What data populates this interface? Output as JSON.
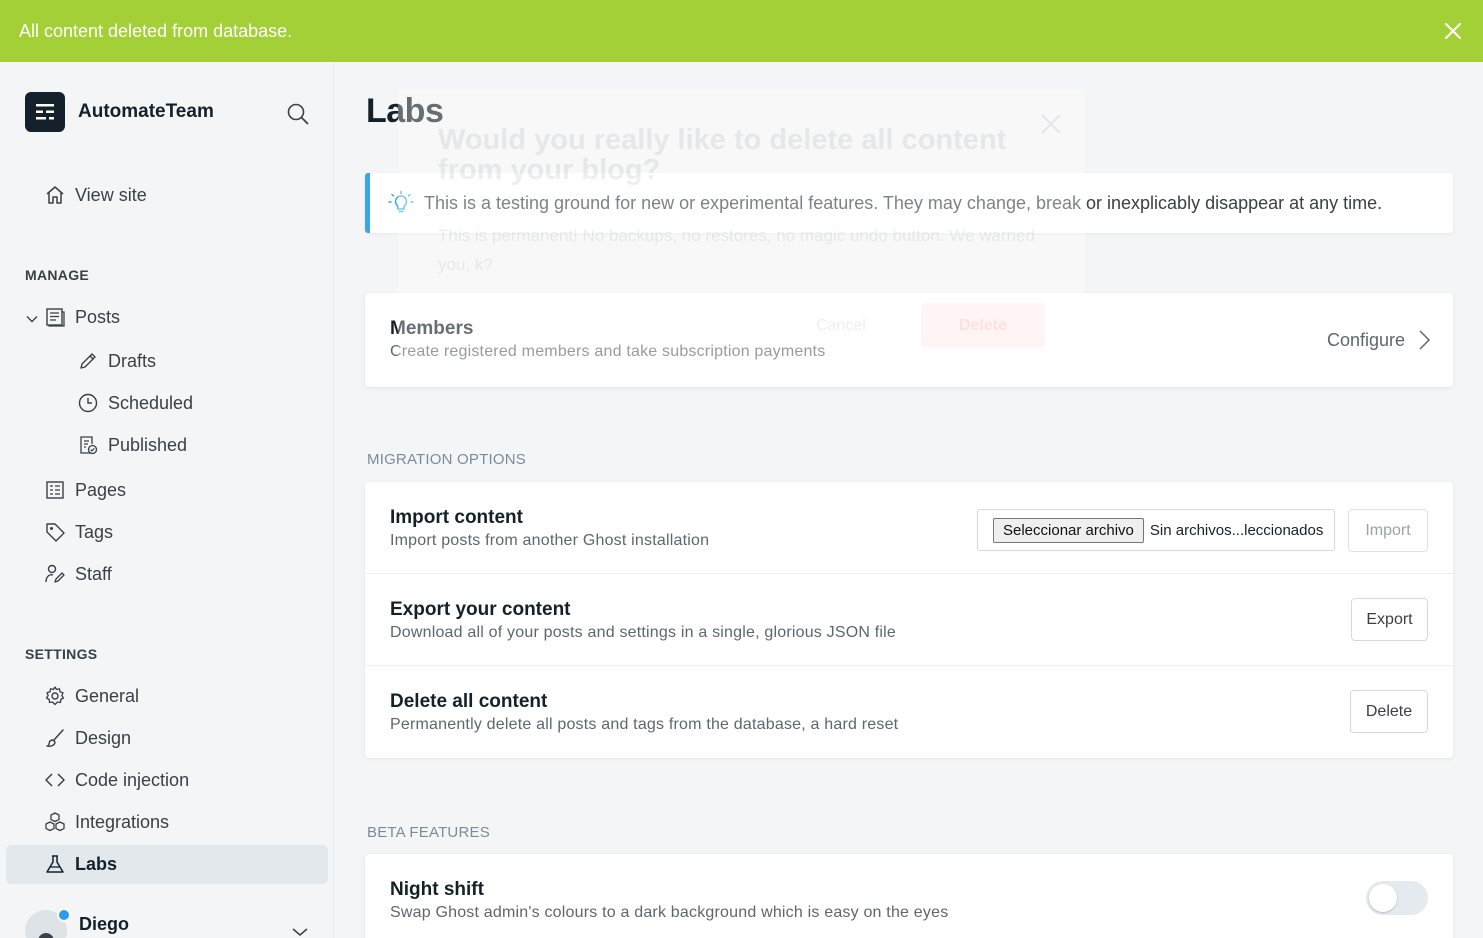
{
  "notification": {
    "message": "All content deleted from database."
  },
  "brand": {
    "name": "AutomateTeam"
  },
  "sidebar": {
    "view_site": "View site",
    "manage_title": "MANAGE",
    "posts": "Posts",
    "drafts": "Drafts",
    "scheduled": "Scheduled",
    "published": "Published",
    "pages": "Pages",
    "tags": "Tags",
    "staff": "Staff",
    "settings_title": "SETTINGS",
    "general": "General",
    "design": "Design",
    "code_injection": "Code injection",
    "integrations": "Integrations",
    "labs": "Labs",
    "user_name": "Diego"
  },
  "main": {
    "title": "Labs",
    "info": "This is a testing ground for new or experimental features. They may change, break or inexplicably disappear at any time.",
    "members": {
      "title": "Members",
      "desc": "Create registered members and take subscription payments",
      "configure": "Configure"
    },
    "migration_title": "MIGRATION OPTIONS",
    "import": {
      "title": "Import content",
      "desc": "Import posts from another Ghost installation",
      "file_button": "Seleccionar archivo",
      "file_status": "Sin archivos...leccionados",
      "button": "Import"
    },
    "export": {
      "title": "Export your content",
      "desc": "Download all of your posts and settings in a single, glorious JSON file",
      "button": "Export"
    },
    "delete": {
      "title": "Delete all content",
      "desc": "Permanently delete all posts and tags from the database, a hard reset",
      "button": "Delete"
    },
    "beta_title": "BETA FEATURES",
    "night_shift": {
      "title": "Night shift",
      "desc": "Swap Ghost admin's colours to a dark background which is easy on the eyes",
      "enabled": false
    }
  },
  "modal": {
    "title": "Would you really like to delete all content from your blog?",
    "desc": "This is permanent! No backups, no restores, no magic undo button. We warned you, k?",
    "cancel": "Cancel",
    "delete": "Delete"
  },
  "colors": {
    "banner": "#a4d037",
    "info_accent": "#38a8e4",
    "sidebar_active": "#e3e8ec",
    "presence_dot": "#2d9cf0"
  },
  "icons": {
    "close": "close-icon",
    "search": "search-icon",
    "home": "home-icon",
    "posts": "posts-icon",
    "drafts": "pencil-icon",
    "scheduled": "clock-icon",
    "published": "published-icon",
    "pages": "pages-icon",
    "tags": "tag-icon",
    "staff": "staff-icon",
    "general": "gear-icon",
    "design": "brush-icon",
    "code": "code-icon",
    "integrations": "cubes-icon",
    "labs": "flask-icon",
    "info": "lightbulb-icon",
    "chevron_right": "chevron-right-icon",
    "chevron_down": "chevron-down-icon"
  }
}
